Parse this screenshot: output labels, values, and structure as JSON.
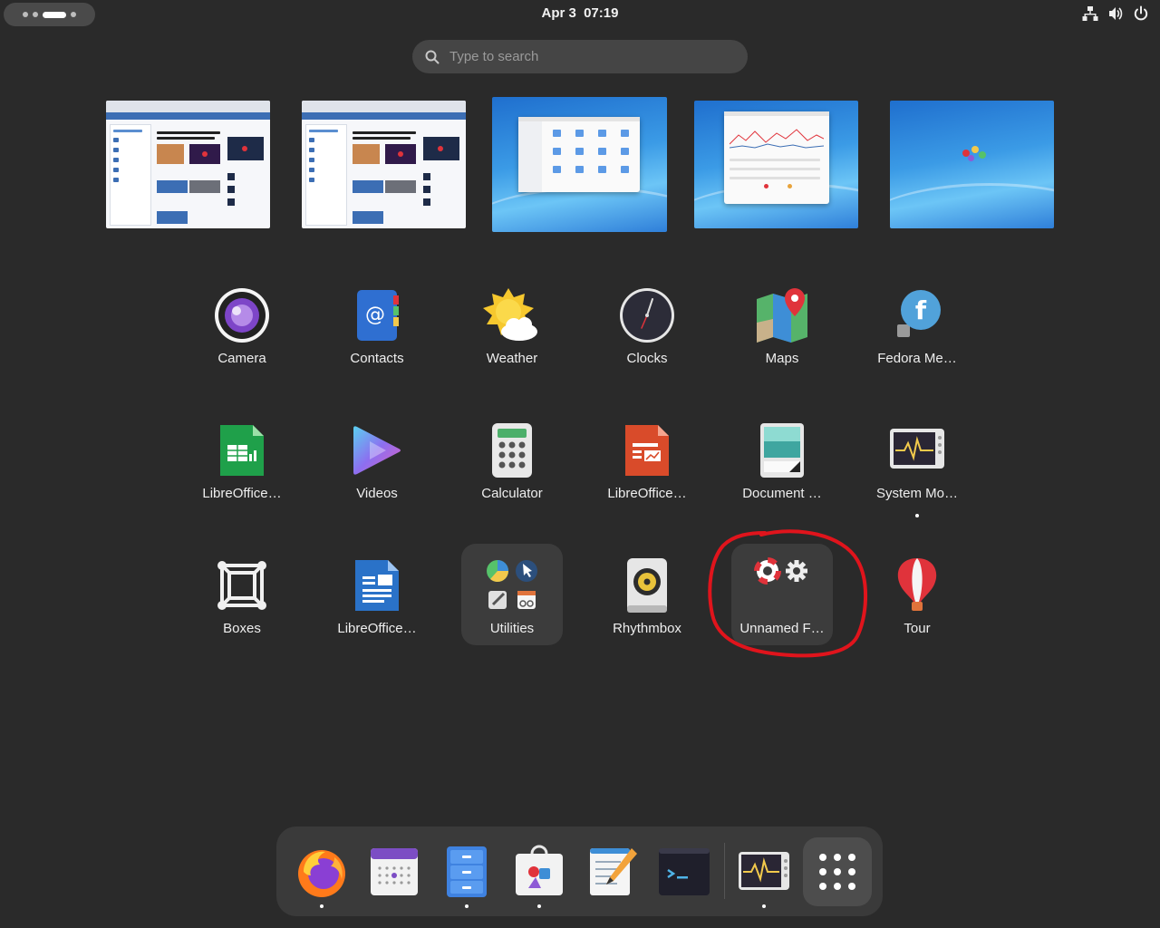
{
  "topbar": {
    "date": "Apr 3",
    "time": "07:19",
    "activities_icon": "workspace-indicator-icon",
    "tray_icons": [
      "network-wired-icon",
      "volume-icon",
      "power-icon"
    ]
  },
  "search": {
    "placeholder": "Type to search"
  },
  "workspaces": {
    "count": 5,
    "active_index": 2,
    "contents": [
      "firefox-fedora-magazine",
      "firefox-fedora-magazine",
      "files-window",
      "system-monitor-window",
      "empty-desktop"
    ]
  },
  "apps": [
    {
      "label": "Camera",
      "icon": "camera-icon"
    },
    {
      "label": "Contacts",
      "icon": "contacts-icon"
    },
    {
      "label": "Weather",
      "icon": "weather-icon"
    },
    {
      "label": "Clocks",
      "icon": "clocks-icon"
    },
    {
      "label": "Maps",
      "icon": "maps-icon"
    },
    {
      "label": "Fedora Me…",
      "icon": "fedora-media-writer-icon"
    },
    {
      "label": "LibreOffice…",
      "icon": "libreoffice-calc-icon"
    },
    {
      "label": "Videos",
      "icon": "videos-icon"
    },
    {
      "label": "Calculator",
      "icon": "calculator-icon"
    },
    {
      "label": "LibreOffice…",
      "icon": "libreoffice-impress-icon"
    },
    {
      "label": "Document …",
      "icon": "document-scanner-icon"
    },
    {
      "label": "System Mo…",
      "icon": "system-monitor-icon",
      "running": true
    },
    {
      "label": "Boxes",
      "icon": "boxes-icon"
    },
    {
      "label": "LibreOffice…",
      "icon": "libreoffice-writer-icon"
    },
    {
      "label": "Utilities",
      "icon": "utilities-folder-icon",
      "folder": true
    },
    {
      "label": "Rhythmbox",
      "icon": "rhythmbox-icon"
    },
    {
      "label": "Unnamed F…",
      "icon": "unnamed-folder-icon",
      "folder": true
    },
    {
      "label": "Tour",
      "icon": "tour-icon"
    }
  ],
  "dock": [
    {
      "name": "Firefox",
      "icon": "firefox-icon",
      "running": true
    },
    {
      "name": "Calendar",
      "icon": "calendar-icon",
      "running": false
    },
    {
      "name": "Files",
      "icon": "files-icon",
      "running": true
    },
    {
      "name": "Software",
      "icon": "software-icon",
      "running": true
    },
    {
      "name": "Text Editor",
      "icon": "text-editor-icon",
      "running": false
    },
    {
      "name": "Terminal",
      "icon": "terminal-icon",
      "running": false
    },
    {
      "name": "System Monitor",
      "icon": "system-monitor-icon",
      "running": true
    },
    {
      "name": "Show Apps",
      "icon": "show-apps-grid-icon"
    }
  ],
  "annotation": {
    "color": "#e0141c",
    "target": "Unnamed F…"
  },
  "colors": {
    "background": "#2a2a2a",
    "dock": "#3a3a3a",
    "folder_tile": "#3c3c3c"
  }
}
